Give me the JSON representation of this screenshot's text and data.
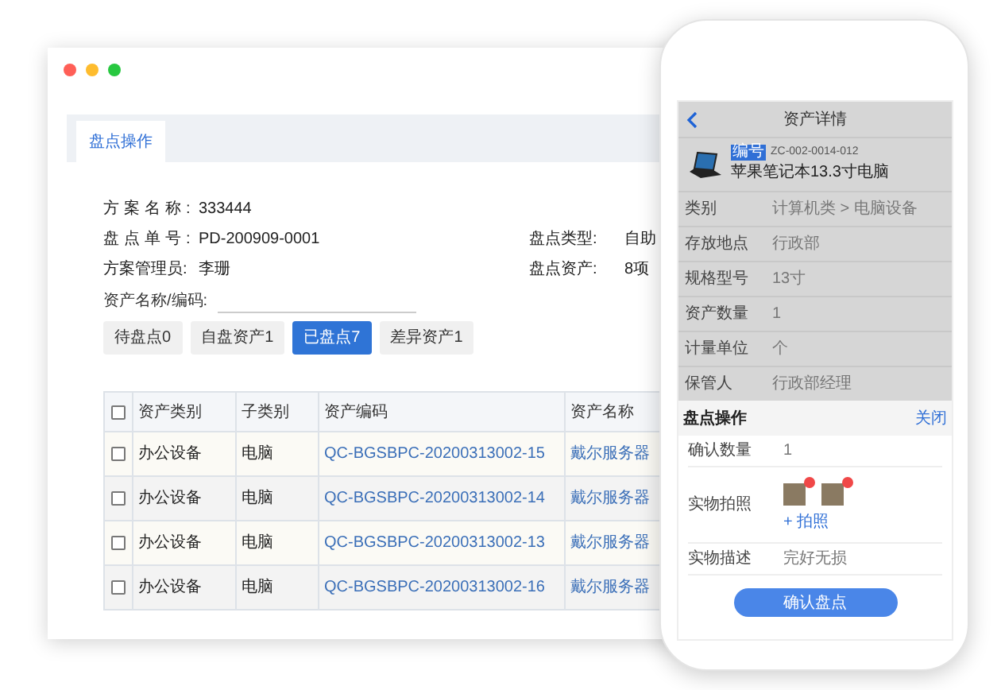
{
  "browser": {
    "tabs": [
      {
        "label": "盘点操作",
        "selected": true
      }
    ],
    "fields": [
      {
        "label": "方案名称:",
        "value": "333444",
        "spaced": true
      },
      {
        "label": "盘点单号:",
        "value": "PD-200909-0001",
        "spaced": true
      },
      {
        "label": "盘点类型:",
        "value": "自助"
      },
      {
        "label": "方案管理员:",
        "value": "李珊",
        "spaced": false
      },
      {
        "label": "盘点资产:",
        "value": "8项"
      }
    ],
    "search": {
      "label": "资产名称/编码:"
    },
    "filters": [
      {
        "label": "待盘点0",
        "selected": false
      },
      {
        "label": "自盘资产1",
        "selected": false
      },
      {
        "label": "已盘点7",
        "selected": true
      },
      {
        "label": "差异资产1",
        "selected": false
      }
    ],
    "table": {
      "header_checked": false,
      "columns": [
        "资产类别",
        "子类别",
        "资产编码",
        "资产名称"
      ],
      "rows": [
        {
          "checked": false,
          "cells": [
            "办公设备",
            "电脑",
            "QC-BGSBPC-20200313002-15",
            "戴尔服务器"
          ]
        },
        {
          "checked": false,
          "cells": [
            "办公设备",
            "电脑",
            "QC-BGSBPC-20200313002-14",
            "戴尔服务器"
          ]
        },
        {
          "checked": false,
          "cells": [
            "办公设备",
            "电脑",
            "QC-BGSBPC-20200313002-13",
            "戴尔服务器"
          ]
        },
        {
          "checked": false,
          "cells": [
            "办公设备",
            "电脑",
            "QC-BGSBPC-20200313002-16",
            "戴尔服务器"
          ]
        }
      ]
    }
  },
  "phone": {
    "title": "资产详情",
    "asset": {
      "badge": "编号",
      "code": "ZC-002-0014-012",
      "name": "苹果笔记本13.3寸电脑"
    },
    "details": [
      {
        "label": "类别",
        "value": "计算机类 > 电脑设备"
      },
      {
        "label": "存放地点",
        "value": "行政部"
      },
      {
        "label": "规格型号",
        "value": "13寸"
      },
      {
        "label": "资产数量",
        "value": "1"
      },
      {
        "label": "计量单位",
        "value": "个"
      },
      {
        "label": "保管人",
        "value": "行政部经理"
      }
    ],
    "sheet": {
      "title": "盘点操作",
      "close": "关闭",
      "rows": [
        {
          "kind": "text",
          "label": "确认数量",
          "value": "1"
        },
        {
          "kind": "photos",
          "label": "实物拍照",
          "photos": [
            {
              "removable": true
            },
            {
              "removable": true
            }
          ],
          "action": "+ 拍照"
        },
        {
          "kind": "text",
          "label": "实物描述",
          "value": "完好无损"
        }
      ],
      "button": "确认盘点"
    }
  }
}
